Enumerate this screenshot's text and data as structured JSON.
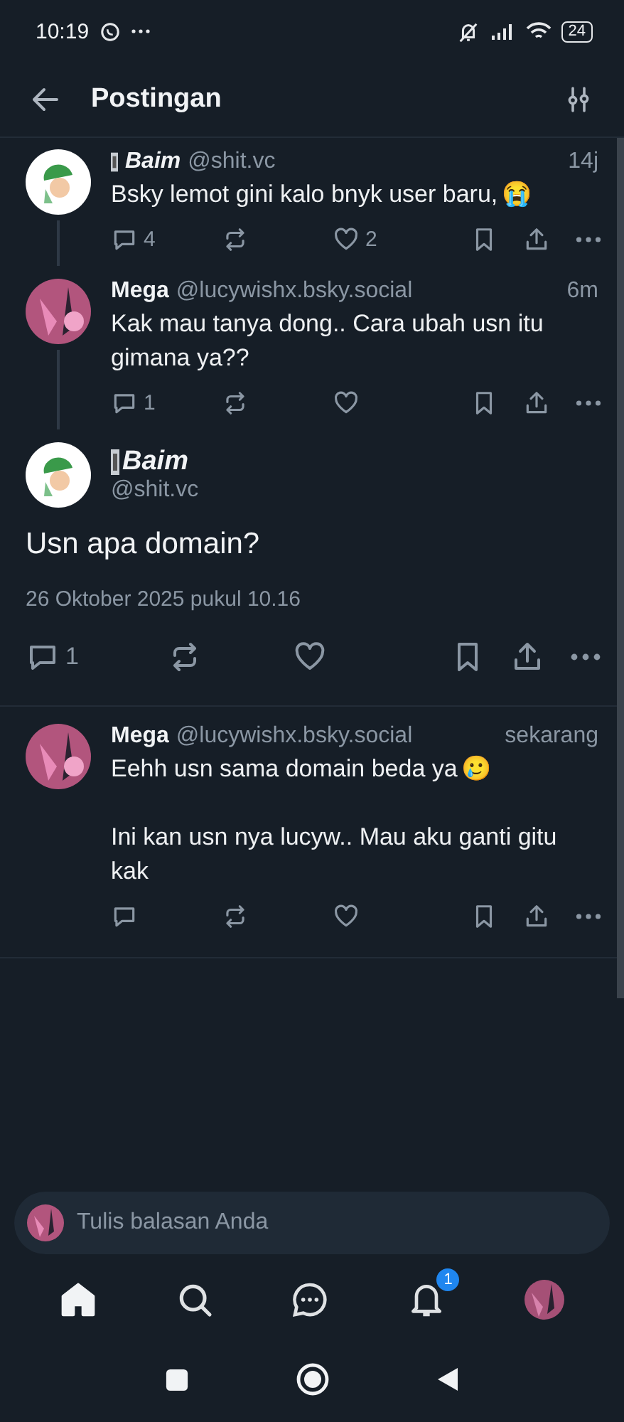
{
  "status_bar": {
    "time": "10:19",
    "battery": "24"
  },
  "header": {
    "title": "Postingan"
  },
  "posts": [
    {
      "kind": "parent",
      "name": "Baim",
      "badge": true,
      "handle": "@shit.vc",
      "time": "14j",
      "text": "Bsky lemot gini kalo bnyk user baru,",
      "emoji": "😭",
      "replies": "4",
      "likes": "2"
    },
    {
      "kind": "parent",
      "name": "Mega",
      "badge": false,
      "handle": "@lucywishx.bsky.social",
      "time": "6m",
      "text": "Kak mau tanya dong.. Cara ubah usn itu gimana ya??",
      "replies": "1"
    },
    {
      "kind": "focus",
      "name": "Baim",
      "badge": true,
      "handle": "@shit.vc",
      "text": "Usn apa domain?",
      "date": "26 Oktober 2025 pukul 10.16",
      "replies": "1"
    },
    {
      "kind": "reply",
      "name": "Mega",
      "badge": false,
      "handle": "@lucywishx.bsky.social",
      "time": "sekarang",
      "text": "Eehh usn sama domain beda ya",
      "emoji": "🥲",
      "text2": "Ini kan usn nya lucyw.. Mau aku ganti gitu kak"
    }
  ],
  "composer": {
    "placeholder": "Tulis balasan Anda"
  },
  "tab_bar": {
    "items": [
      {
        "kind": "home",
        "selected": true
      },
      {
        "kind": "search",
        "selected": false
      },
      {
        "kind": "chat",
        "selected": false
      },
      {
        "kind": "bell",
        "selected": false,
        "badge": "1"
      },
      {
        "kind": "profile",
        "selected": false
      }
    ]
  }
}
